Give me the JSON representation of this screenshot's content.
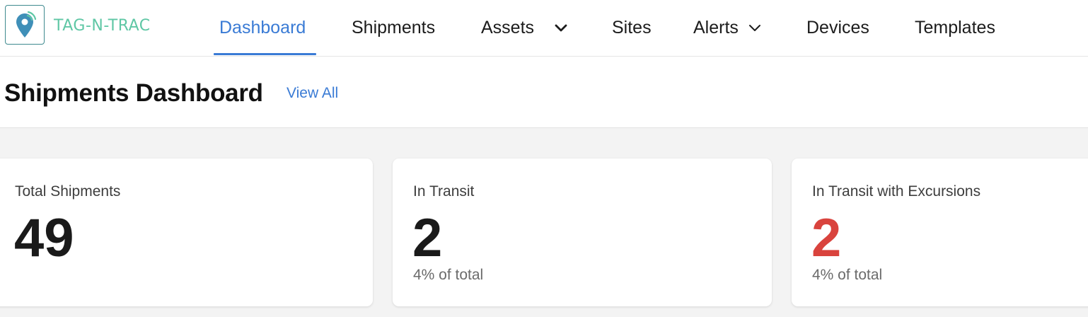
{
  "brand": {
    "name": "TAG-N-TRAC",
    "color": "#5fc7a5",
    "icon": "location-pin-icon"
  },
  "nav": {
    "dashboard": "Dashboard",
    "shipments": "Shipments",
    "assets": "Assets",
    "sites": "Sites",
    "alerts": "Alerts",
    "devices": "Devices",
    "templates": "Templates",
    "active": "Dashboard",
    "accent_color": "#3a7bd5"
  },
  "header": {
    "title": "Shipments Dashboard",
    "view_all": "View All"
  },
  "cards": [
    {
      "label": "Total Shipments",
      "value": "49",
      "sub": ""
    },
    {
      "label": "In Transit",
      "value": "2",
      "sub": "4% of total"
    },
    {
      "label": "In Transit with Excursions",
      "value": "2",
      "sub": "4% of total",
      "value_color": "#d9433d"
    }
  ]
}
